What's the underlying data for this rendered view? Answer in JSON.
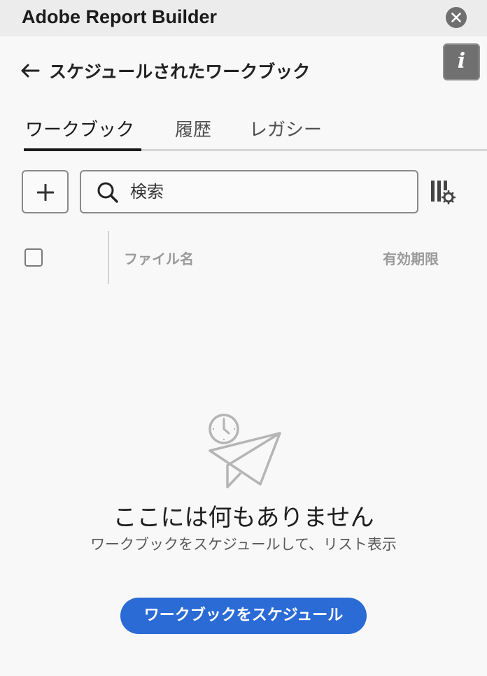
{
  "titlebar": {
    "title": "Adobe Report Builder",
    "close_icon": "close-icon"
  },
  "header": {
    "back_icon": "arrow-left-icon",
    "title": "スケジュールされたワークブック",
    "info_label": "i"
  },
  "tabs": [
    {
      "label": "ワークブック",
      "active": true
    },
    {
      "label": "履歴",
      "active": false
    },
    {
      "label": "レガシー",
      "active": false
    }
  ],
  "toolbar": {
    "add_icon": "plus-icon",
    "search_placeholder": "検索",
    "search_value": "",
    "column_settings_icon": "column-settings-icon"
  },
  "table": {
    "columns": [
      "ファイル名",
      "有効期限"
    ],
    "rows": []
  },
  "empty_state": {
    "icon": "clock-paper-plane-icon",
    "title": "ここには何もありません",
    "subtitle": "ワークブックをスケジュールして、リスト表示",
    "button_label": "ワークブックをスケジュール"
  },
  "colors": {
    "accent": "#2b6bd6",
    "titlebar_bg": "#ececec",
    "page_bg": "#f8f8f8"
  }
}
